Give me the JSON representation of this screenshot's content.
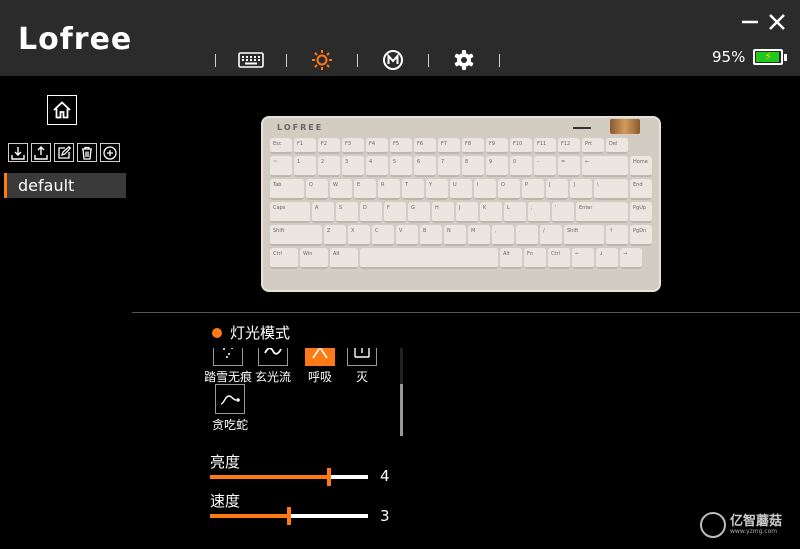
{
  "app": {
    "logo": "Lofree"
  },
  "window": {
    "minimize_icon": "minimize-icon",
    "close_icon": "close-icon"
  },
  "tabs": [
    {
      "name": "keys",
      "icon": "keyboard-icon"
    },
    {
      "name": "lighting",
      "icon": "sun-icon",
      "active": true,
      "color": "#ff7a14"
    },
    {
      "name": "macro",
      "icon": "macro-icon"
    },
    {
      "name": "settings",
      "icon": "gear-icon"
    }
  ],
  "battery": {
    "percent_text": "95%",
    "level": 0.95,
    "color": "#22c81e"
  },
  "sidebar": {
    "home_icon": "home-icon",
    "tools": [
      "import-icon",
      "export-icon",
      "edit-icon",
      "delete-icon",
      "add-icon"
    ],
    "profiles": [
      {
        "label": "default",
        "selected": true
      }
    ]
  },
  "keyboard": {
    "brand": "LOFREE",
    "rows": [
      [
        "Esc",
        "F1",
        "F2",
        "F3",
        "F4",
        "F5",
        "F6",
        "F7",
        "F8",
        "F9",
        "F10",
        "F11",
        "F12",
        "Prt",
        "Del"
      ],
      [
        "~",
        "1",
        "2",
        "3",
        "4",
        "5",
        "6",
        "7",
        "8",
        "9",
        "0",
        "-",
        "=",
        "←",
        "Home"
      ],
      [
        "Tab",
        "Q",
        "W",
        "E",
        "R",
        "T",
        "Y",
        "U",
        "I",
        "O",
        "P",
        "[",
        "]",
        "\\",
        "End"
      ],
      [
        "Caps",
        "A",
        "S",
        "D",
        "F",
        "G",
        "H",
        "J",
        "K",
        "L",
        ";",
        "'",
        "Enter",
        "PgUp"
      ],
      [
        "Shift",
        "Z",
        "X",
        "C",
        "V",
        "B",
        "N",
        "M",
        ",",
        ".",
        "/",
        "Shift",
        "↑",
        "PgDn"
      ],
      [
        "Ctrl",
        "Win",
        "Alt",
        "",
        "Alt",
        "Fn",
        "Ctrl",
        "←",
        "↓",
        "→"
      ]
    ]
  },
  "lighting": {
    "title": "灯光模式",
    "modes": [
      {
        "label": "踏雪无痕",
        "icon": "snow-icon"
      },
      {
        "label": "玄光流",
        "icon": "wave-icon"
      },
      {
        "label": "呼吸",
        "icon": "breath-icon",
        "selected": true
      },
      {
        "label": "灭",
        "icon": "off-icon"
      },
      {
        "label": "贪吃蛇",
        "icon": "snake-icon"
      }
    ],
    "brightness": {
      "label": "亮度",
      "value": "4",
      "level": 0.75
    },
    "speed": {
      "label": "速度",
      "value": "3",
      "level": 0.5
    }
  },
  "watermark": {
    "text": "亿智蘑菇",
    "sub": "www.yzmg.com"
  }
}
